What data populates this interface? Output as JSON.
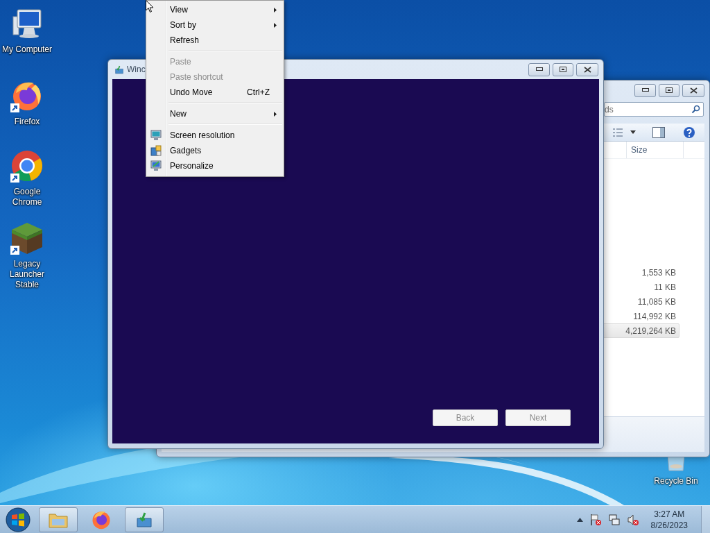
{
  "desktop_icons": [
    {
      "label": "My Computer",
      "kind": "computer",
      "shortcut": false
    },
    {
      "label": "Firefox",
      "kind": "fox",
      "shortcut": true
    },
    {
      "label": "Google Chrome",
      "kind": "ring",
      "shortcut": true
    },
    {
      "label": "Legacy Launcher Stable",
      "kind": "block",
      "shortcut": true
    }
  ],
  "recycle_bin": {
    "label": "Recycle Bin"
  },
  "explorer_window": {
    "search": {
      "placeholder": "ds"
    },
    "columns": [
      "Size"
    ],
    "rows": [
      {
        "size": "1,553 KB",
        "selected": false
      },
      {
        "size": "11 KB",
        "selected": false
      },
      {
        "size": "11,085 KB",
        "selected": false
      },
      {
        "size": "114,992 KB",
        "selected": false
      },
      {
        "size": "4,219,264 KB",
        "selected": true
      }
    ]
  },
  "setup_window": {
    "title": "Winc",
    "buttons": [
      {
        "label": "Back",
        "disabled": true
      },
      {
        "label": "Next",
        "disabled": true
      }
    ]
  },
  "context_menu": {
    "items": [
      {
        "kind": "command",
        "label": "View",
        "submenu": true,
        "disabled": false
      },
      {
        "kind": "command",
        "label": "Sort by",
        "submenu": true,
        "disabled": false
      },
      {
        "kind": "command",
        "label": "Refresh",
        "submenu": false,
        "disabled": false
      },
      {
        "kind": "separator"
      },
      {
        "kind": "command",
        "label": "Paste",
        "submenu": false,
        "disabled": true
      },
      {
        "kind": "command",
        "label": "Paste shortcut",
        "submenu": false,
        "disabled": true
      },
      {
        "kind": "command",
        "label": "Undo Move",
        "shortcut": "Ctrl+Z",
        "submenu": false,
        "disabled": false
      },
      {
        "kind": "separator"
      },
      {
        "kind": "command",
        "label": "New",
        "submenu": true,
        "disabled": false
      },
      {
        "kind": "separator"
      },
      {
        "kind": "display",
        "label": "Screen resolution",
        "submenu": false,
        "disabled": false
      },
      {
        "kind": "gadgets",
        "label": "Gadgets",
        "submenu": false,
        "disabled": false
      },
      {
        "kind": "personalize",
        "label": "Personalize",
        "submenu": false,
        "disabled": false
      }
    ]
  },
  "taskbar": {
    "buttons": [
      {
        "kind": "folder",
        "running": true
      },
      {
        "kind": "fox",
        "running": false
      },
      {
        "kind": "setup",
        "running": true
      }
    ],
    "clock": {
      "time": "3:27 AM",
      "date": "8/26/2023"
    }
  }
}
